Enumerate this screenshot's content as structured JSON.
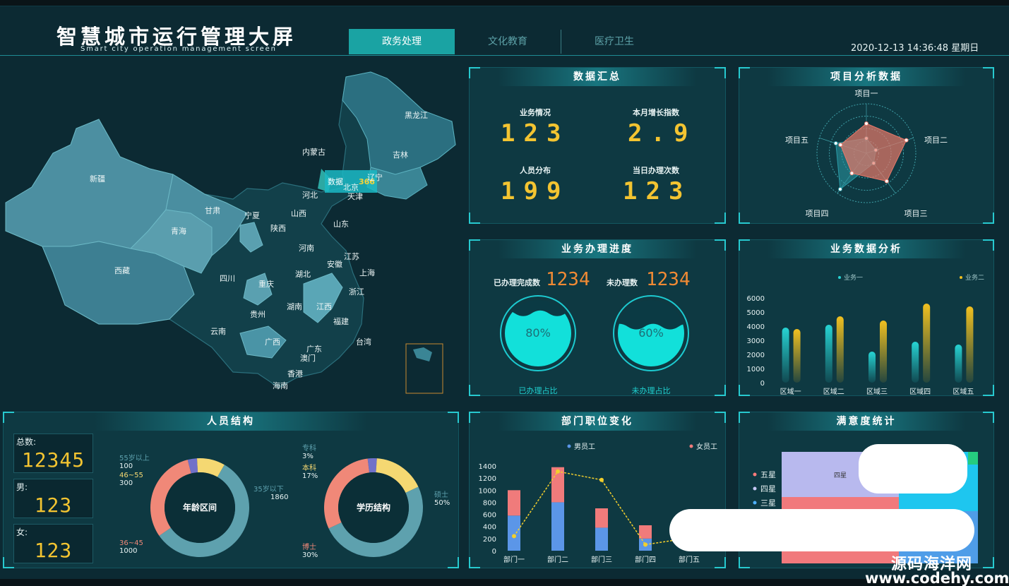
{
  "header": {
    "title": "智慧城市运行管理大屏",
    "subtitle": "Smart city operation management screen",
    "tabs": [
      {
        "label": "政务处理"
      },
      {
        "label": "文化教育"
      },
      {
        "label": "医疗卫生"
      }
    ],
    "datetime": "2020-12-13 14:36:48 星期日"
  },
  "map": {
    "provinces": [
      "黑龙江",
      "吉林",
      "内蒙古",
      "辽宁",
      "新疆",
      "北京",
      "天津",
      "河北",
      "甘肃",
      "宁夏",
      "山西",
      "青海",
      "陕西",
      "山东",
      "河南",
      "江苏",
      "安徽",
      "上海",
      "西藏",
      "四川",
      "湖北",
      "重庆",
      "浙江",
      "贵州",
      "湖南",
      "江西",
      "云南",
      "福建",
      "广西",
      "广东",
      "台湾",
      "澳门",
      "香港",
      "海南"
    ],
    "tooltip": {
      "label": "数据",
      "value": "366"
    }
  },
  "summary": {
    "title": "数据汇总",
    "items": [
      {
        "label": "业务情况",
        "value": "123"
      },
      {
        "label": "本月增长指数",
        "value": "2.9"
      },
      {
        "label": "人员分布",
        "value": "199"
      },
      {
        "label": "当日办理次数",
        "value": "123"
      }
    ]
  },
  "radar": {
    "title": "项目分析数据",
    "indicators": [
      "项目一",
      "项目二",
      "项目三",
      "项目四",
      "项目五"
    ],
    "colors": [
      "#e8796a",
      "#2a9aa6"
    ]
  },
  "progress": {
    "title": "业务办理进度",
    "done_label": "已办理完成数",
    "done_value": "1234",
    "todo_label": "未办理数",
    "todo_value": "1234",
    "gauges": [
      {
        "pct": "80%",
        "caption": "已办理占比",
        "level": 0.8
      },
      {
        "pct": "60%",
        "caption": "未办理占比",
        "level": 0.6
      }
    ]
  },
  "bars": {
    "title": "业务数据分析",
    "legend": [
      "业务一",
      "业务二"
    ]
  },
  "people": {
    "title": "人员结构",
    "stats": [
      {
        "label": "总数:",
        "value": "12345"
      },
      {
        "label": "男:",
        "value": "123"
      },
      {
        "label": "女:",
        "value": "123"
      }
    ],
    "age": {
      "center": "年龄区间",
      "labels": [
        {
          "name": "55岁以上",
          "value": "100"
        },
        {
          "name": "46~55",
          "value": "300"
        },
        {
          "name": "35岁以下",
          "value": "1860"
        },
        {
          "name": "36~45",
          "value": "1000"
        }
      ]
    },
    "edu": {
      "center": "学历结构",
      "labels": [
        {
          "name": "专科",
          "value": "3%"
        },
        {
          "name": "本科",
          "value": "17%"
        },
        {
          "name": "硕士",
          "value": "50%"
        },
        {
          "name": "博士",
          "value": "30%"
        }
      ]
    }
  },
  "dept": {
    "title": "部门职位变化",
    "legend": [
      "男员工",
      "女员工"
    ]
  },
  "satisfaction": {
    "title": "满意度统计",
    "legend": [
      "五星",
      "四星",
      "三星"
    ],
    "block_label": "四星"
  },
  "watermark": {
    "line1": "源码海洋网",
    "line2": "www.codehy.com"
  },
  "chart_data": [
    {
      "type": "radar",
      "indicators": [
        "项目一",
        "项目二",
        "项目三",
        "项目四",
        "项目五"
      ],
      "series": [
        {
          "values": [
            60,
            85,
            70,
            50,
            55
          ]
        },
        {
          "values": [
            30,
            20,
            25,
            90,
            65
          ]
        }
      ]
    },
    {
      "type": "bar",
      "categories": [
        "区域一",
        "区域二",
        "区域三",
        "区域四",
        "区域五"
      ],
      "series": [
        {
          "name": "业务一",
          "values": [
            3900,
            4100,
            2200,
            2900,
            2700
          ]
        },
        {
          "name": "业务二",
          "values": [
            3800,
            4700,
            4400,
            5600,
            5400
          ]
        }
      ],
      "ylim": [
        0,
        6000
      ],
      "yticks": [
        0,
        1000,
        2000,
        3000,
        4000,
        5000,
        6000
      ]
    },
    {
      "type": "bar",
      "stacked": true,
      "categories": [
        "部门一",
        "部门二",
        "部门三",
        "部门四",
        "部门五"
      ],
      "series": [
        {
          "name": "男员工",
          "values": [
            580,
            800,
            380,
            200,
            0
          ]
        },
        {
          "name": "女员工",
          "values": [
            420,
            580,
            320,
            220,
            0
          ]
        }
      ],
      "line": [
        240,
        1310,
        1170,
        100,
        210
      ],
      "ylim": [
        0,
        1400
      ],
      "yticks": [
        0,
        200,
        400,
        600,
        800,
        1000,
        1200,
        1400
      ]
    },
    {
      "type": "pie",
      "title": "年龄区间",
      "categories": [
        "55岁以上",
        "46~55",
        "35岁以下",
        "36~45"
      ],
      "values": [
        100,
        300,
        1860,
        1000
      ]
    },
    {
      "type": "pie",
      "title": "学历结构",
      "categories": [
        "专科",
        "本科",
        "硕士",
        "博士"
      ],
      "values": [
        3,
        17,
        50,
        30
      ]
    }
  ]
}
